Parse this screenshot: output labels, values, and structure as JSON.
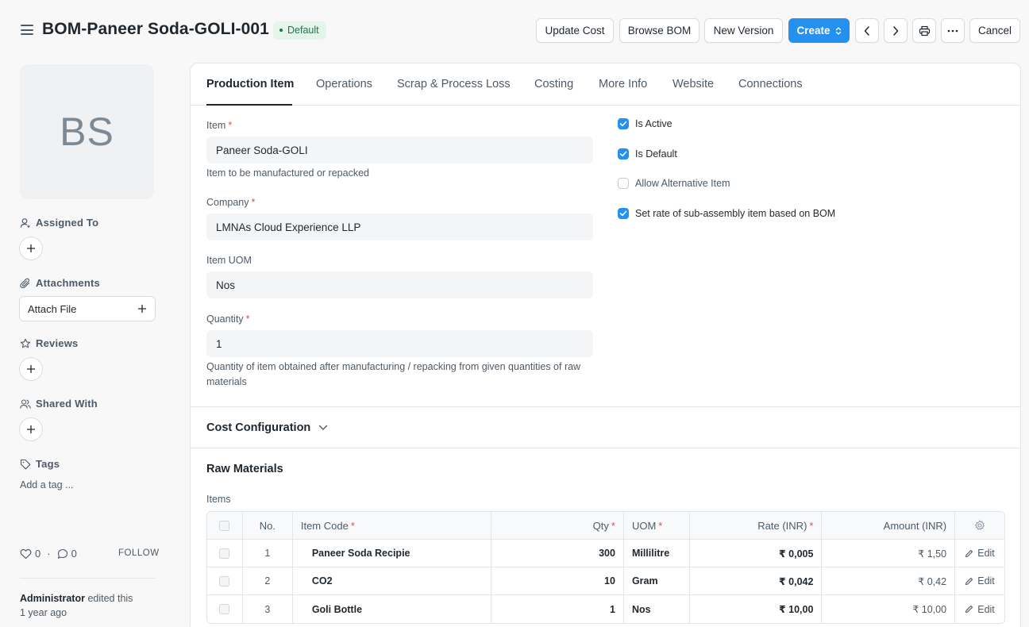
{
  "header": {
    "title": "BOM-Paneer Soda-GOLI-001",
    "status": "Default",
    "buttons": {
      "update_cost": "Update Cost",
      "browse_bom": "Browse BOM",
      "new_version": "New Version",
      "create": "Create",
      "cancel": "Cancel"
    }
  },
  "sidebar": {
    "avatar_initials": "BS",
    "assigned_to": "Assigned To",
    "attachments": "Attachments",
    "attach_file": "Attach File",
    "reviews": "Reviews",
    "shared_with": "Shared With",
    "tags": "Tags",
    "add_tag": "Add a tag ...",
    "likes": "0",
    "comments": "0",
    "follow": "FOLLOW",
    "edited_by": "Administrator",
    "edited_text": "edited this",
    "edited_time": "1 year ago"
  },
  "tabs": [
    {
      "label": "Production Item",
      "active": true
    },
    {
      "label": "Operations"
    },
    {
      "label": "Scrap & Process Loss"
    },
    {
      "label": "Costing"
    },
    {
      "label": "More Info"
    },
    {
      "label": "Website"
    },
    {
      "label": "Connections"
    }
  ],
  "form": {
    "item_label": "Item",
    "item_value": "Paneer Soda-GOLI",
    "item_desc": "Item to be manufactured or repacked",
    "company_label": "Company",
    "company_value": "LMNAs Cloud Experience LLP",
    "uom_label": "Item UOM",
    "uom_value": "Nos",
    "qty_label": "Quantity",
    "qty_value": "1",
    "qty_desc": "Quantity of item obtained after manufacturing / repacking from given quantities of raw materials"
  },
  "checks": [
    {
      "label": "Is Active",
      "checked": true
    },
    {
      "label": "Is Default",
      "checked": true
    },
    {
      "label": "Allow Alternative Item",
      "checked": false
    },
    {
      "label": "Set rate of sub-assembly item based on BOM",
      "checked": true
    }
  ],
  "sections": {
    "cost_configuration": "Cost Configuration",
    "raw_materials": "Raw Materials",
    "items_label": "Items"
  },
  "table": {
    "headers": {
      "no": "No.",
      "item_code": "Item Code",
      "qty": "Qty",
      "uom": "UOM",
      "rate": "Rate (INR)",
      "amount": "Amount (INR)"
    },
    "edit_label": "Edit",
    "rows": [
      {
        "no": "1",
        "item_code": "Paneer Soda Recipie",
        "qty": "300",
        "uom": "Millilitre",
        "rate": "₹ 0,005",
        "amount": "₹ 1,50"
      },
      {
        "no": "2",
        "item_code": "CO2",
        "qty": "10",
        "uom": "Gram",
        "rate": "₹ 0,042",
        "amount": "₹ 0,42"
      },
      {
        "no": "3",
        "item_code": "Goli Bottle",
        "qty": "1",
        "uom": "Nos",
        "rate": "₹ 10,00",
        "amount": "₹ 10,00"
      }
    ]
  },
  "colors": {
    "primary": "#2490ef",
    "success_bg": "#e4f5e9",
    "success_text": "#16794c",
    "required": "#e24c4c"
  }
}
